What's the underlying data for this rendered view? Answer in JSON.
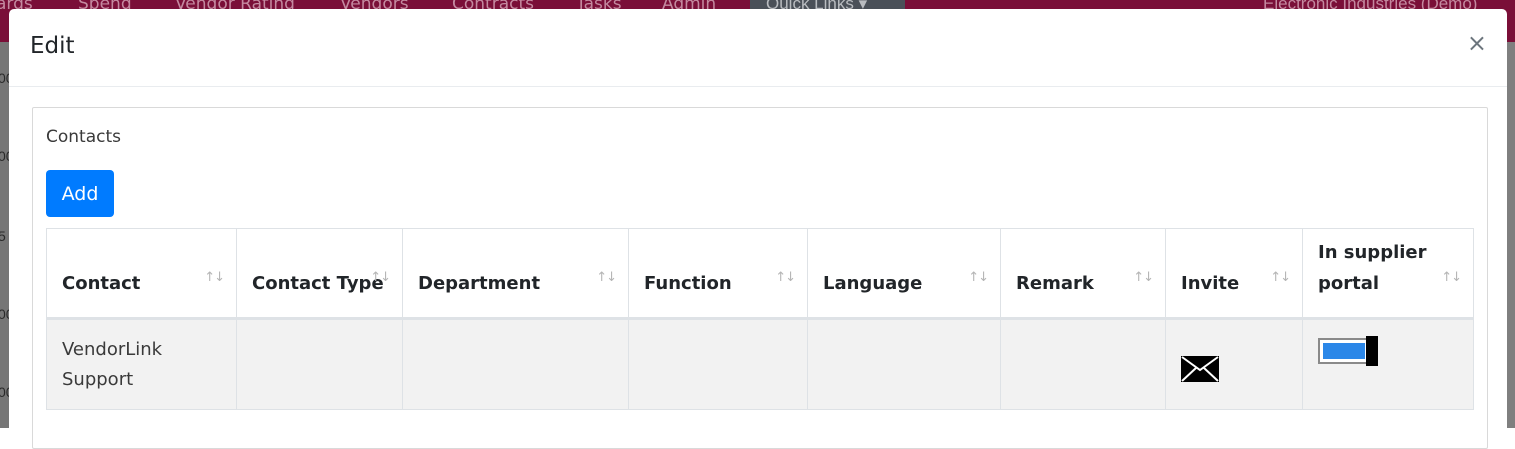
{
  "background": {
    "nav_items": [
      "ards",
      "Spend",
      "Vendor Rating",
      "Vendors",
      "Contracts",
      "Tasks",
      "Admin"
    ],
    "quick_links": "Quick Links ▾",
    "organization": "Electronic Industries (Demo)",
    "side_fragments": [
      "00",
      "00",
      "5",
      "00",
      "00"
    ]
  },
  "modal": {
    "title": "Edit",
    "close_label": "×",
    "section_label": "Contacts",
    "add_label": "Add",
    "table": {
      "headers": [
        "Contact",
        "Contact Type",
        "Department",
        "Function",
        "Language",
        "Remark",
        "Invite",
        "In supplier portal"
      ],
      "sort_glyph": "↑↓",
      "rows": [
        {
          "contact": "VendorLink Support",
          "contact_type": "",
          "department": "",
          "function": "",
          "language": "",
          "remark": "",
          "invite_icon": "envelope-icon",
          "in_supplier_portal": true
        }
      ]
    }
  },
  "colors": {
    "brand_nav": "#7a0f38",
    "primary_button": "#007bff",
    "toggle_fill": "#2b87e8"
  }
}
